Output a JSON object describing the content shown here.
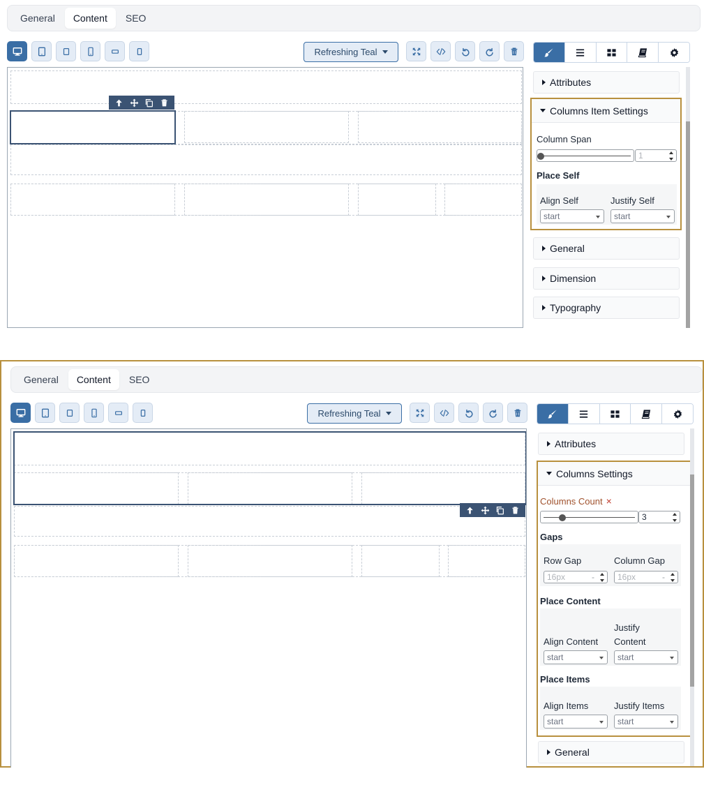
{
  "tabs": {
    "general": "General",
    "content": "Content",
    "seo": "SEO"
  },
  "theme": {
    "label": "Refreshing Teal"
  },
  "devices": [
    {
      "icon": "desktop-icon"
    },
    {
      "icon": "tablet-icon"
    },
    {
      "icon": "tablet-small-icon"
    },
    {
      "icon": "mobile-icon"
    },
    {
      "icon": "mobile-landscape-icon"
    },
    {
      "icon": "mobile-small-icon"
    }
  ],
  "canvas_tools": [
    {
      "icon": "fullscreen-icon"
    },
    {
      "icon": "code-icon"
    },
    {
      "icon": "undo-icon"
    },
    {
      "icon": "redo-icon"
    },
    {
      "icon": "trash-icon"
    }
  ],
  "side_tabs": [
    {
      "icon": "brush-icon"
    },
    {
      "icon": "layers-icon"
    },
    {
      "icon": "blocks-icon"
    },
    {
      "icon": "book-icon"
    },
    {
      "icon": "gear-icon"
    }
  ],
  "element_toolbar": [
    {
      "icon": "arrow-up-icon"
    },
    {
      "icon": "move-icon"
    },
    {
      "icon": "copy-icon"
    },
    {
      "icon": "trash-icon"
    }
  ],
  "panel1": {
    "sections": {
      "attributes": "Attributes",
      "settings_title": "Columns Item Settings",
      "general": "General",
      "dimension": "Dimension",
      "typography": "Typography"
    },
    "column_span": {
      "label": "Column Span",
      "value": "1",
      "slider_fraction": 0.0
    },
    "place_self": {
      "heading": "Place Self",
      "align_label": "Align Self",
      "align_value": "start",
      "justify_label": "Justify Self",
      "justify_value": "start"
    }
  },
  "panel2": {
    "sections": {
      "attributes": "Attributes",
      "settings_title": "Columns Settings",
      "general": "General"
    },
    "columns_count": {
      "label": "Columns Count",
      "clear_symbol": "×",
      "value": "3",
      "slider_fraction": 0.2
    },
    "gaps": {
      "heading": "Gaps",
      "row_label": "Row Gap",
      "row_placeholder": "16px",
      "row_unit": "-",
      "col_label": "Column Gap",
      "col_placeholder": "16px",
      "col_unit": "-"
    },
    "place_content": {
      "heading": "Place Content",
      "align_label": "Align Content",
      "align_value": "start",
      "justify_label_1": "Justify",
      "justify_label_2": "Content",
      "justify_value": "start"
    },
    "place_items": {
      "heading": "Place Items",
      "align_label": "Align Items",
      "align_value": "start",
      "justify_label": "Justify Items",
      "justify_value": "start"
    }
  },
  "colors": {
    "accent": "#3a6ea5",
    "highlight_border": "#b8903e",
    "selection": "#3b5373"
  }
}
